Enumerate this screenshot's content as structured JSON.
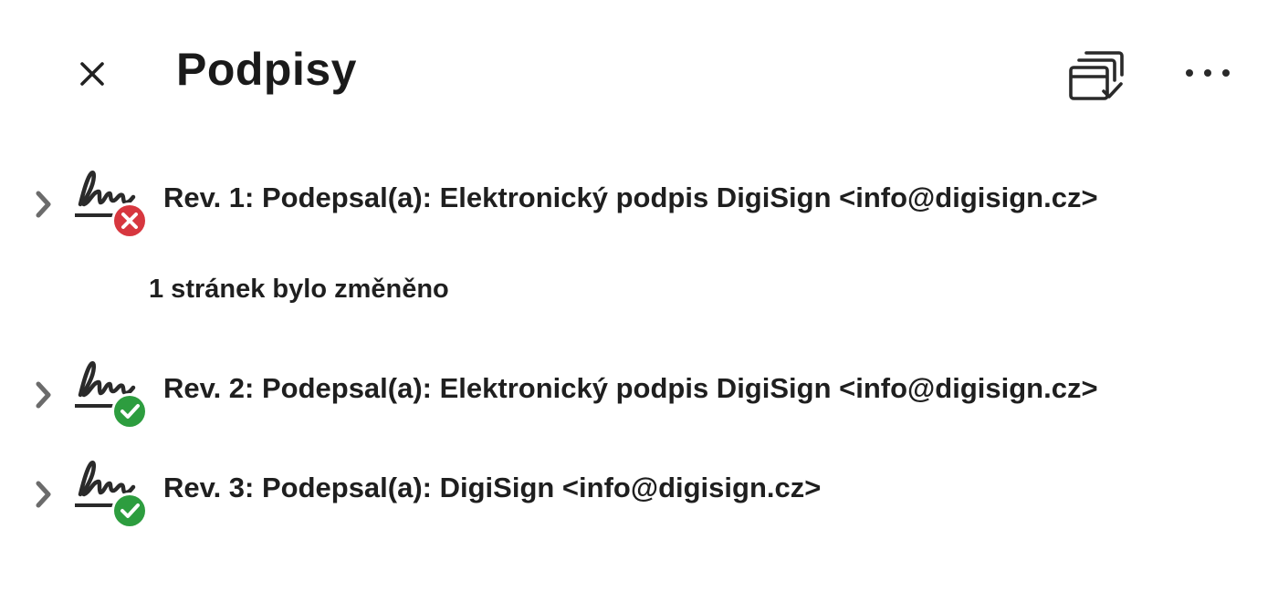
{
  "header": {
    "title": "Podpisy",
    "close_icon": "close-icon",
    "validate_icon": "validate-all-signatures-icon",
    "more_icon": "more-options-icon"
  },
  "signatures": [
    {
      "label": "Rev. 1: Podepsal(a): Elektronický podpis DigiSign <info@digisign.cz>",
      "status": "invalid",
      "status_color": "#d7373f",
      "note": "1 stránek bylo změněno"
    },
    {
      "label": "Rev. 2: Podepsal(a): Elektronický podpis DigiSign <info@digisign.cz>",
      "status": "valid",
      "status_color": "#2d9d3f"
    },
    {
      "label": "Rev. 3: Podepsal(a): DigiSign <info@digisign.cz>",
      "status": "valid",
      "status_color": "#2d9d3f"
    }
  ],
  "colors": {
    "text": "#1f1f1f",
    "icon": "#2c2c2c",
    "invalid": "#d7373f",
    "valid": "#2d9d3f"
  }
}
